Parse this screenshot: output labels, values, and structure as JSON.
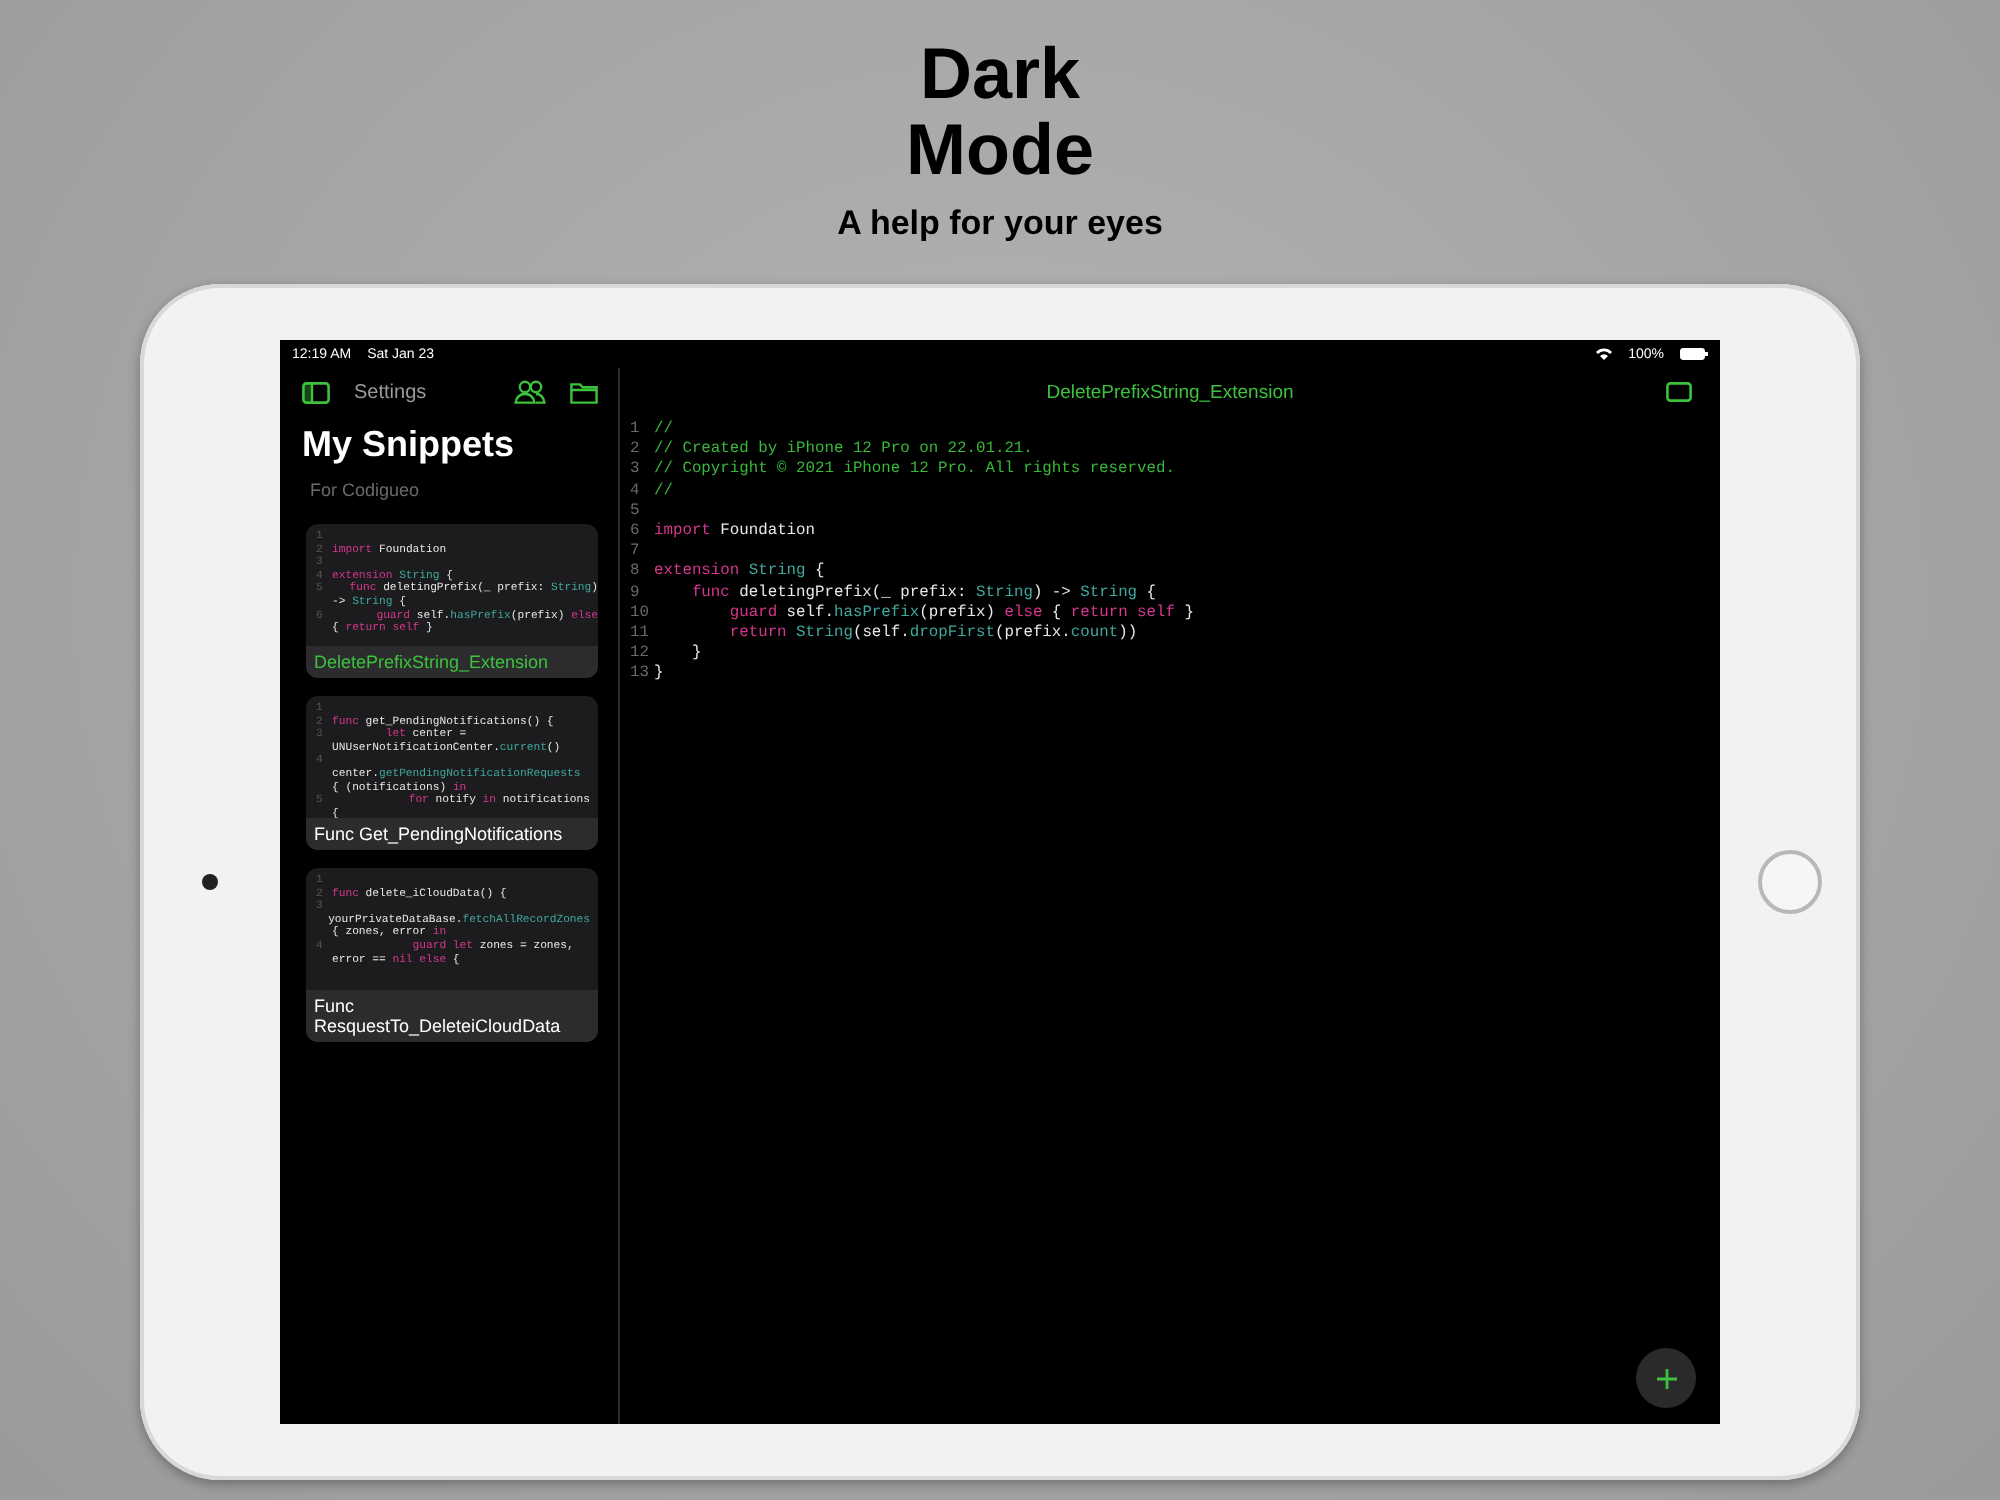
{
  "header": {
    "title_lines": [
      "Dark",
      "Mode"
    ],
    "subtitle": "A help for your eyes"
  },
  "status_bar": {
    "time": "12:19 AM",
    "date": "Sat Jan 23",
    "battery": "100%"
  },
  "sidebar": {
    "settings": "Settings",
    "title": "My Snippets",
    "subtitle": "For Codigueo",
    "cards": [
      {
        "title": "DeletePrefixString_Extension",
        "selected": true,
        "rows": [
          {
            "n": "1"
          },
          {
            "n": "2",
            "tokens": [
              {
                "kind": "keyword",
                "text": "import"
              },
              {
                "kind": "plain",
                "text": " Foundation"
              }
            ]
          },
          {
            "n": "3"
          },
          {
            "n": "4",
            "tokens": [
              {
                "kind": "keyword",
                "text": "extension "
              },
              {
                "kind": "type",
                "text": "String"
              },
              {
                "kind": "plain",
                "text": " {"
              }
            ]
          },
          {
            "n": "5",
            "tokens": [
              {
                "kind": "keyword",
                "text": "    func"
              },
              {
                "kind": "plain",
                "text": " deletingPrefix(_ prefix: "
              },
              {
                "kind": "type",
                "text": "String"
              },
              {
                "kind": "plain",
                "text": ")"
              }
            ]
          },
          {
            "tokens": [
              {
                "kind": "plain",
                "text": "-> "
              },
              {
                "kind": "type",
                "text": "String"
              },
              {
                "kind": "plain",
                "text": " {"
              }
            ]
          },
          {
            "n": "6",
            "tokens": [
              {
                "kind": "keyword",
                "text": "        guard"
              },
              {
                "kind": "plain",
                "text": " self."
              },
              {
                "kind": "type",
                "text": "hasPrefix"
              },
              {
                "kind": "plain",
                "text": "(prefix) "
              },
              {
                "kind": "keyword",
                "text": "else"
              }
            ]
          },
          {
            "tokens": [
              {
                "kind": "plain",
                "text": "{ "
              },
              {
                "kind": "keyword",
                "text": "return self"
              },
              {
                "kind": "plain",
                "text": " }"
              }
            ]
          }
        ]
      },
      {
        "title": "Func Get_PendingNotifications",
        "selected": false,
        "rows": [
          {
            "n": "1"
          },
          {
            "n": "2",
            "tokens": [
              {
                "kind": "keyword",
                "text": "func"
              },
              {
                "kind": "plain",
                "text": " get_PendingNotifications() {"
              }
            ]
          },
          {
            "n": "3",
            "tokens": [
              {
                "kind": "keyword",
                "text": "        let"
              },
              {
                "kind": "plain",
                "text": " center ="
              }
            ]
          },
          {
            "tokens": [
              {
                "kind": "plain",
                "text": "UNUserNotificationCenter."
              },
              {
                "kind": "type",
                "text": "current"
              },
              {
                "kind": "plain",
                "text": "()"
              }
            ]
          },
          {
            "n": "4"
          },
          {
            "tokens": [
              {
                "kind": "plain",
                "text": "center."
              },
              {
                "kind": "type",
                "text": "getPendingNotificationRequests"
              }
            ]
          },
          {
            "tokens": [
              {
                "kind": "plain",
                "text": "{ (notifications) "
              },
              {
                "kind": "keyword",
                "text": "in"
              }
            ]
          },
          {
            "n": "5",
            "tokens": [
              {
                "kind": "keyword",
                "text": "            for"
              },
              {
                "kind": "plain",
                "text": " notify "
              },
              {
                "kind": "keyword",
                "text": "in"
              },
              {
                "kind": "plain",
                "text": " notifications"
              }
            ]
          },
          {
            "tokens": [
              {
                "kind": "plain",
                "text": "{"
              }
            ]
          }
        ]
      },
      {
        "title": "Func ResquestTo_DeleteiCloudData",
        "selected": false,
        "rows": [
          {
            "n": "1"
          },
          {
            "n": "2",
            "tokens": [
              {
                "kind": "keyword",
                "text": "func"
              },
              {
                "kind": "plain",
                "text": " delete_iCloudData() {"
              }
            ]
          },
          {
            "n": "3"
          },
          {
            "tokens": [
              {
                "kind": "plain",
                "text": "yourPrivateDataBase."
              },
              {
                "kind": "type",
                "text": "fetchAllRecordZones"
              }
            ]
          },
          {
            "tokens": [
              {
                "kind": "plain",
                "text": "{ zones, error "
              },
              {
                "kind": "keyword",
                "text": "in"
              }
            ]
          },
          {
            "n": "4",
            "tokens": [
              {
                "kind": "keyword",
                "text": "            guard let"
              },
              {
                "kind": "plain",
                "text": " zones = zones,"
              }
            ]
          },
          {
            "tokens": [
              {
                "kind": "plain",
                "text": "error == "
              },
              {
                "kind": "keyword",
                "text": "nil else"
              },
              {
                "kind": "plain",
                "text": " {"
              }
            ]
          }
        ]
      }
    ]
  },
  "editor": {
    "title": "DeletePrefixString_Extension",
    "lines": [
      {
        "n": "1",
        "tokens": [
          {
            "kind": "comment",
            "text": "//"
          }
        ]
      },
      {
        "n": "2",
        "tokens": [
          {
            "kind": "comment",
            "text": "// Created by iPhone 12 Pro on 22.01.21."
          }
        ]
      },
      {
        "n": "3",
        "tokens": [
          {
            "kind": "comment",
            "text": "// Copyright © 2021 iPhone 12 Pro. All rights reserved."
          }
        ]
      },
      {
        "n": "4",
        "tokens": [
          {
            "kind": "comment",
            "text": "//"
          }
        ]
      },
      {
        "n": "5"
      },
      {
        "n": "6",
        "tokens": [
          {
            "kind": "keyword",
            "text": "import"
          },
          {
            "kind": "plain",
            "text": " Foundation"
          }
        ]
      },
      {
        "n": "7"
      },
      {
        "n": "8",
        "tokens": [
          {
            "kind": "keyword",
            "text": "extension "
          },
          {
            "kind": "type",
            "text": "String"
          },
          {
            "kind": "plain",
            "text": " {"
          }
        ]
      },
      {
        "n": "9",
        "tokens": [
          {
            "kind": "keyword",
            "text": "    func"
          },
          {
            "kind": "plain",
            "text": " deletingPrefix(_ prefix: "
          },
          {
            "kind": "type",
            "text": "String"
          },
          {
            "kind": "plain",
            "text": ") -> "
          },
          {
            "kind": "type",
            "text": "String"
          },
          {
            "kind": "plain",
            "text": " {"
          }
        ]
      },
      {
        "n": "10",
        "tokens": [
          {
            "kind": "keyword",
            "text": "        guard"
          },
          {
            "kind": "plain",
            "text": " self."
          },
          {
            "kind": "type",
            "text": "hasPrefix"
          },
          {
            "kind": "plain",
            "text": "(prefix) "
          },
          {
            "kind": "keyword",
            "text": "else"
          },
          {
            "kind": "plain",
            "text": " { "
          },
          {
            "kind": "keyword",
            "text": "return self"
          },
          {
            "kind": "plain",
            "text": " }"
          }
        ]
      },
      {
        "n": "11",
        "tokens": [
          {
            "kind": "keyword",
            "text": "        return "
          },
          {
            "kind": "type",
            "text": "String"
          },
          {
            "kind": "plain",
            "text": "(self."
          },
          {
            "kind": "type",
            "text": "dropFirst"
          },
          {
            "kind": "plain",
            "text": "(prefix."
          },
          {
            "kind": "type",
            "text": "count"
          },
          {
            "kind": "plain",
            "text": "))"
          }
        ]
      },
      {
        "n": "12",
        "tokens": [
          {
            "kind": "plain",
            "text": "    }"
          }
        ]
      },
      {
        "n": "13",
        "tokens": [
          {
            "kind": "plain",
            "text": "}"
          }
        ]
      }
    ]
  }
}
